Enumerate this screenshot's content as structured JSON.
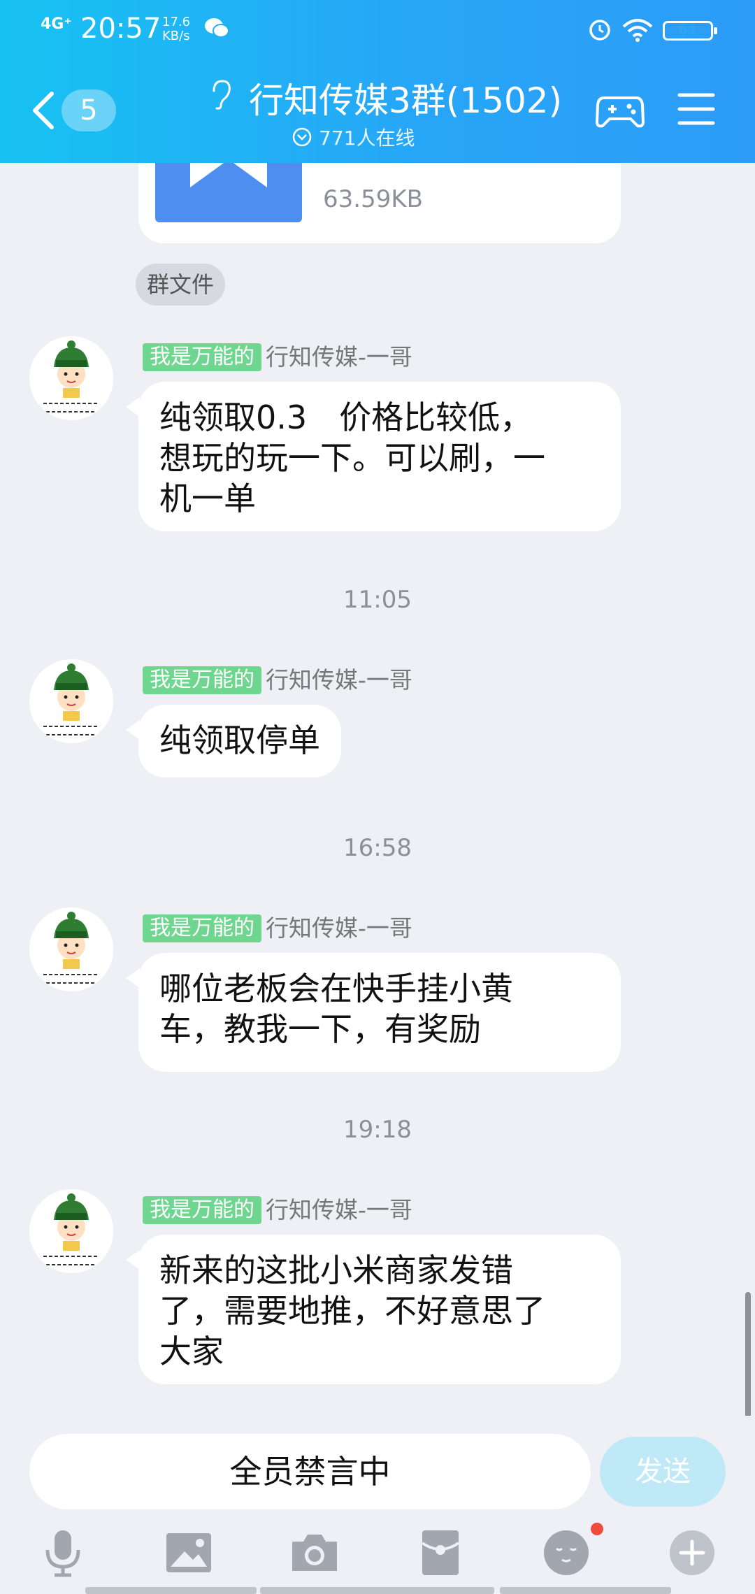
{
  "status_bar": {
    "signal": "4G⁺",
    "time": "20:57",
    "speed_value": "17.6",
    "speed_unit": "KB/s",
    "battery": "61"
  },
  "header": {
    "unread_count": "5",
    "group_title": "行知传媒3群(1502)",
    "online_text": "771人在线"
  },
  "file_message": {
    "size": "63.59KB",
    "chip_label": "群文件"
  },
  "messages": [
    {
      "tag": "我是万能的",
      "sender": "行知传媒-一哥",
      "lines": [
        "纯领取0.3　价格比较低，",
        "想玩的玩一下。可以刷，一",
        "机一单"
      ]
    },
    {
      "timestamp": "11:05",
      "tag": "我是万能的",
      "sender": "行知传媒-一哥",
      "lines": [
        "纯领取停单"
      ]
    },
    {
      "timestamp": "16:58",
      "tag": "我是万能的",
      "sender": "行知传媒-一哥",
      "lines": [
        "哪位老板会在快手挂小黄",
        "车，教我一下，有奖励"
      ]
    },
    {
      "timestamp": "19:18",
      "tag": "我是万能的",
      "sender": "行知传媒-一哥",
      "lines": [
        "新来的这批小米商家发错",
        "了，需要地推，不好意思了",
        "大家"
      ]
    }
  ],
  "input": {
    "muted_text": "全员禁言中",
    "send_label": "发送"
  },
  "toolbar": {
    "icons": [
      "microphone-icon",
      "image-icon",
      "camera-icon",
      "red-packet-icon",
      "emoji-icon",
      "plus-icon"
    ]
  },
  "colors": {
    "header_start": "#17c2f2",
    "header_end": "#2c9cf7",
    "tag_green": "#6fd68f",
    "send_disabled": "#bfe9f7",
    "notification_dot": "#f04b3c"
  }
}
